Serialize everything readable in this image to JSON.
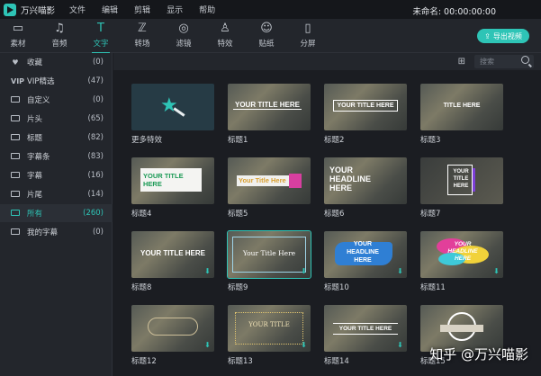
{
  "app": {
    "title": "万兴喵影",
    "project_title": "未命名: 00:00:00:00"
  },
  "menu": [
    "文件",
    "编辑",
    "剪辑",
    "显示",
    "帮助"
  ],
  "toolbar": {
    "tools": [
      {
        "label": "素材",
        "icon": "media-icon"
      },
      {
        "label": "音频",
        "icon": "music-icon"
      },
      {
        "label": "文字",
        "icon": "text-icon"
      },
      {
        "label": "转场",
        "icon": "transition-icon"
      },
      {
        "label": "滤镜",
        "icon": "filter-icon"
      },
      {
        "label": "特效",
        "icon": "effects-icon"
      },
      {
        "label": "贴纸",
        "icon": "sticker-icon"
      },
      {
        "label": "分屏",
        "icon": "split-screen-icon"
      }
    ],
    "active": "文字",
    "export_label": "导出视频"
  },
  "sidebar": {
    "items": [
      {
        "label": "收藏",
        "count": "(0)",
        "icon": "heart-icon"
      },
      {
        "label": "VIP精选",
        "count": "(47)",
        "icon": "vip-icon",
        "icon_text": "VIP"
      },
      {
        "label": "自定义",
        "count": "(0)",
        "icon": "folder-icon"
      },
      {
        "label": "片头",
        "count": "(65)",
        "icon": "folder-icon"
      },
      {
        "label": "标题",
        "count": "(82)",
        "icon": "folder-icon"
      },
      {
        "label": "字幕条",
        "count": "(83)",
        "icon": "folder-icon"
      },
      {
        "label": "字幕",
        "count": "(16)",
        "icon": "folder-icon"
      },
      {
        "label": "片尾",
        "count": "(14)",
        "icon": "folder-icon"
      },
      {
        "label": "所有",
        "count": "(260)",
        "icon": "folder-icon"
      },
      {
        "label": "我的字幕",
        "count": "(0)",
        "icon": "folder-icon"
      }
    ],
    "active": "所有"
  },
  "search": {
    "placeholder": "搜索"
  },
  "grid": {
    "cards": [
      {
        "label": "更多特效",
        "thumb_text": "",
        "icon": "magic-wand-icon"
      },
      {
        "label": "标题1",
        "thumb_text": "YOUR TITLE HERE"
      },
      {
        "label": "标题2",
        "thumb_text": "YOUR TITLE HERE"
      },
      {
        "label": "标题3",
        "thumb_text": "TITLE HERE"
      },
      {
        "label": "标题4",
        "thumb_text": "YOUR TITLE HERE"
      },
      {
        "label": "标题5",
        "thumb_text": "Your Title Here"
      },
      {
        "label": "标题6",
        "thumb_text": "YOUR HEADLINE HERE"
      },
      {
        "label": "标题7",
        "thumb_text": "YOUR TITLE HERE"
      },
      {
        "label": "标题8",
        "thumb_text": "YOUR TITLE HERE"
      },
      {
        "label": "标题9",
        "thumb_text": "Your Title Here"
      },
      {
        "label": "标题10",
        "thumb_text": "YOUR HEADLINE HERE"
      },
      {
        "label": "标题11",
        "thumb_text": "YOUR HEADLINE HERE"
      },
      {
        "label": "标题12",
        "thumb_text": ""
      },
      {
        "label": "标题13",
        "thumb_text": "YOUR TITLE"
      },
      {
        "label": "标题14",
        "thumb_text": "YOUR TITLE HERE"
      },
      {
        "label": "标题15",
        "thumb_text": ""
      }
    ]
  },
  "watermark": "知乎 @万兴喵影",
  "colors": {
    "accent": "#2ec4b6",
    "background": "#1b1d22",
    "panel": "#23262c"
  }
}
